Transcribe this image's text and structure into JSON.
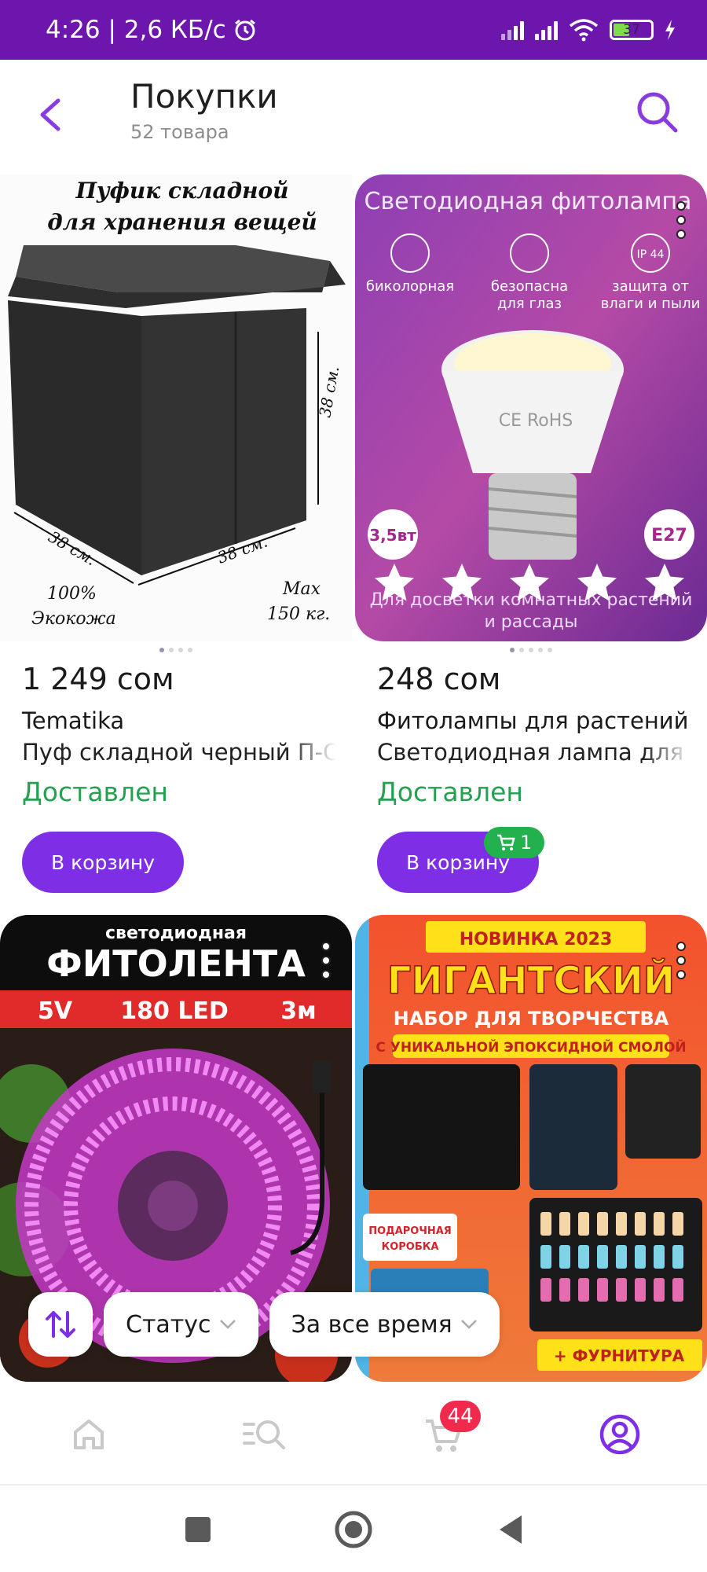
{
  "status_bar": {
    "time_speed": "4:26 | 2,6 КБ/с",
    "battery": "37"
  },
  "header": {
    "title": "Покупки",
    "subtitle": "52 товара"
  },
  "products": [
    {
      "image_text": [
        "Пуфик складной",
        "для хранения вещей",
        "38 см.",
        "38 см.",
        "38 см.",
        "100%",
        "Экокожа",
        "Max",
        "150 кг."
      ],
      "price": "1 249 сом",
      "brand": "Tematika",
      "name": "Пуф складной черный П-С",
      "status": "Доставлен",
      "cart_label": "В корзину"
    },
    {
      "image_text": [
        "Светодиодная фитолампа",
        "биколорная",
        "безопасна",
        "для глаз",
        "IP 44",
        "защита от",
        "влаги и пыли",
        "CE RoHS",
        "3,5вт",
        "E27",
        "Для досветки комнатных растений",
        "и рассады"
      ],
      "price": "248 сом",
      "brand": "Фитолампы для растений",
      "name": "Светодиодная лампа для",
      "status": "Доставлен",
      "cart_label": "В корзину",
      "in_cart_count": "1"
    },
    {
      "image_text": [
        "светодиодная",
        "ФИТОЛЕНТА",
        "5V",
        "180 LED",
        "3м"
      ]
    },
    {
      "image_text": [
        "НОВИНКА 2023",
        "ГИГАНТСКИЙ",
        "НАБОР ДЛЯ ТВОРЧЕСТВА",
        "С УНИКАЛЬНОЙ ЭПОКСИДНОЙ СМОЛОЙ",
        "ПОДАРОЧНАЯ",
        "КОРОБКА",
        "+ ФУРНИТУРА"
      ]
    }
  ],
  "filters": {
    "status": "Статус",
    "period": "За все время"
  },
  "bottom_nav": {
    "cart_badge": "44"
  },
  "colors": {
    "status_bar": "#6c16ad",
    "accent": "#7e2fe6",
    "delivered": "#24a150",
    "badge": "#f0294d"
  }
}
